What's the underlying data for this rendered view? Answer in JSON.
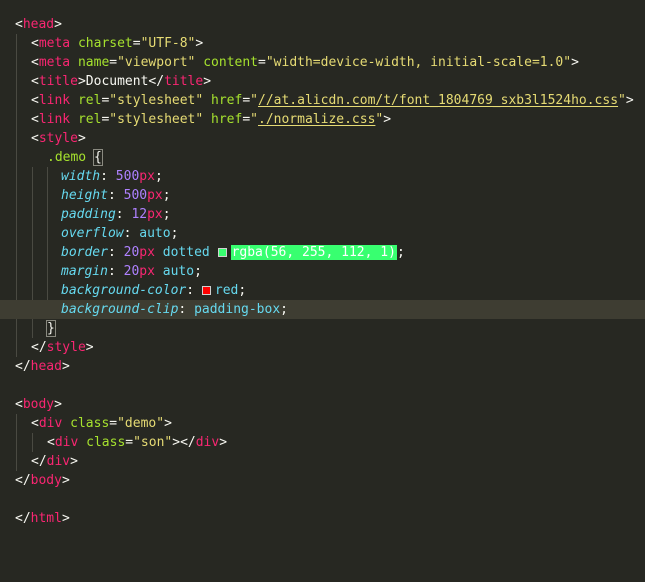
{
  "colors": {
    "background": "#272822",
    "tag": "#f92672",
    "attribute": "#a6e22e",
    "string": "#e6db74",
    "property": "#66d9ef",
    "number": "#ae81ff",
    "green_swatch": "#38ff70",
    "red_swatch": "#ff0000"
  },
  "editor": {
    "head_open": "head",
    "meta1": {
      "tag": "meta",
      "attr": "charset",
      "val": "\"UTF-8\""
    },
    "meta2": {
      "tag": "meta",
      "attr1": "name",
      "val1": "\"viewport\"",
      "attr2": "content",
      "val2": "\"width=device-width, initial-scale=1.0\""
    },
    "title": {
      "tag": "title",
      "text": "Document"
    },
    "link1": {
      "tag": "link",
      "attr1": "rel",
      "val1": "\"stylesheet\"",
      "attr2": "href",
      "href": "//at.alicdn.com/t/font_1804769_sxb3l1524ho.css"
    },
    "link2": {
      "tag": "link",
      "attr1": "rel",
      "val1": "\"stylesheet\"",
      "attr2": "href",
      "href": "./normalize.css"
    },
    "style_tag": "style",
    "selector": ".demo",
    "rules": {
      "width": {
        "prop": "width",
        "num": "500",
        "unit": "px"
      },
      "height": {
        "prop": "height",
        "num": "500",
        "unit": "px"
      },
      "padding": {
        "prop": "padding",
        "num": "12",
        "unit": "px"
      },
      "overflow": {
        "prop": "overflow",
        "value": "auto"
      },
      "border": {
        "prop": "border",
        "num": "20",
        "unit": "px",
        "style": "dotted",
        "color": "rgba(56, 255, 112, 1)"
      },
      "margin": {
        "prop": "margin",
        "num": "20",
        "unit": "px",
        "rest": "auto"
      },
      "background_color": {
        "prop": "background-color",
        "value": "red"
      },
      "background_clip": {
        "prop": "background-clip",
        "value": "padding-box"
      }
    },
    "head_close": "head",
    "body_tag": "body",
    "div_tag": "div",
    "class_attr": "class",
    "demo_class": "\"demo\"",
    "son_class": "\"son\"",
    "html_tag": "html"
  }
}
